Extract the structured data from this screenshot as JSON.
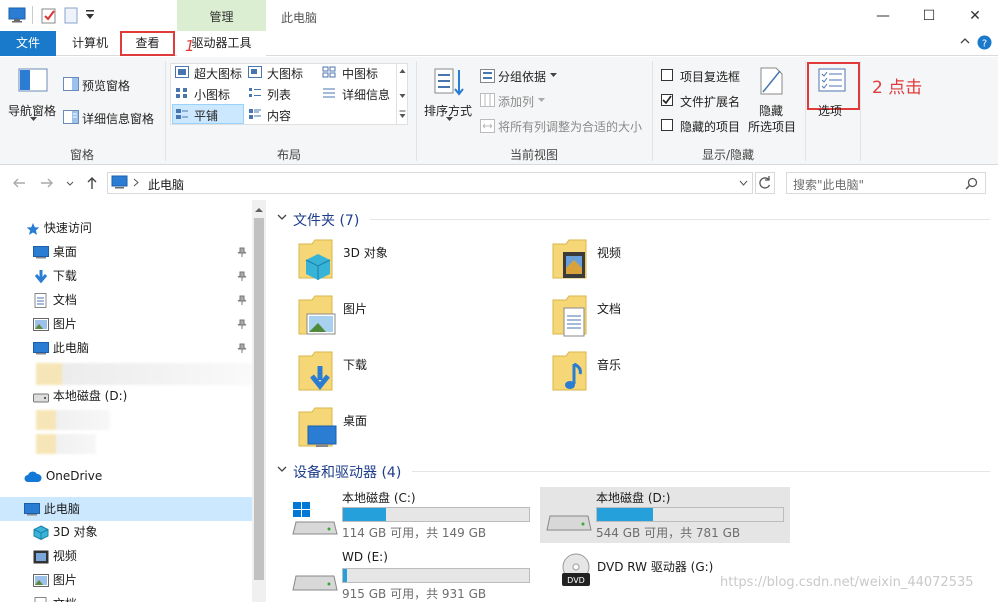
{
  "titlebar": {
    "manage_tab": "管理",
    "title": "此电脑",
    "minimize": "—",
    "maximize": "☐",
    "close": "✕"
  },
  "tabs": {
    "file": "文件",
    "computer": "计算机",
    "view": "查看",
    "drive_tools": "驱动器工具",
    "annotation_1": "1"
  },
  "ribbon": {
    "pane": {
      "nav_pane": "导航窗格",
      "preview_pane": "预览窗格",
      "details_pane": "详细信息窗格",
      "group": "窗格"
    },
    "layout": {
      "extra_large": "超大图标",
      "large": "大图标",
      "medium": "中图标",
      "small": "小图标",
      "list": "列表",
      "details": "详细信息",
      "tiles": "平铺",
      "content": "内容",
      "group": "布局"
    },
    "current_view": {
      "sort_by": "排序方式",
      "group_by": "分组依据",
      "add_columns": "添加列",
      "size_all_columns": "将所有列调整为合适的大小",
      "group": "当前视图"
    },
    "show_hide": {
      "item_checkboxes": "项目复选框",
      "file_extensions": "文件扩展名",
      "hidden_items": "隐藏的项目",
      "hide_selected_1": "隐藏",
      "hide_selected_2": "所选项目",
      "group": "显示/隐藏",
      "item_checkboxes_checked": false,
      "file_extensions_checked": true,
      "hidden_items_checked": false
    },
    "options": "选项",
    "annotation_2": "2 点击"
  },
  "address": {
    "path": "此电脑",
    "search_placeholder": "搜索\"此电脑\""
  },
  "navpane": {
    "quick_access": "快速访问",
    "desktop": "桌面",
    "downloads": "下载",
    "documents": "文档",
    "pictures": "图片",
    "this_pc": "此电脑",
    "local_disk_d": "本地磁盘 (D:)",
    "onedrive": "OneDrive",
    "this_pc_2": "此电脑",
    "objects_3d": "3D 对象",
    "videos": "视频",
    "pictures_2": "图片",
    "documents_2": "文档"
  },
  "content": {
    "folders_header": "文件夹 (7)",
    "folders": [
      "3D 对象",
      "视频",
      "图片",
      "文档",
      "下载",
      "音乐",
      "桌面"
    ],
    "devices_header": "设备和驱动器 (4)",
    "drives": [
      {
        "name": "本地磁盘 (C:)",
        "size": "114 GB 可用，共 149 GB",
        "used_fraction": 0.23
      },
      {
        "name": "本地磁盘 (D:)",
        "size": "544 GB 可用，共 781 GB",
        "used_fraction": 0.3
      },
      {
        "name": "WD (E:)",
        "size": "915 GB 可用，共 931 GB",
        "used_fraction": 0.02
      },
      {
        "name": "DVD RW 驱动器 (G:)",
        "size": "",
        "used_fraction": 0
      }
    ],
    "watermark": "https://blog.csdn.net/weixin_44072535"
  },
  "colors": {
    "accent": "#1979ca",
    "manage_tab": "#dbeed2",
    "annotation_red": "#e13a3a",
    "drive_fill": "#26a0da"
  }
}
